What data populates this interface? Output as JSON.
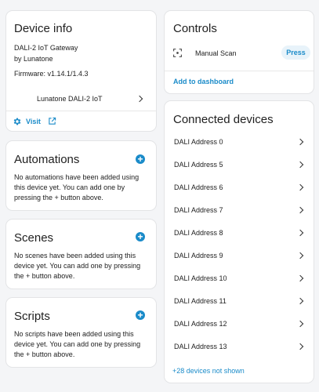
{
  "device_info": {
    "title": "Device info",
    "model": "DALI-2 IoT Gateway",
    "manufacturer": "by Lunatone",
    "firmware": "Firmware: v1.14.1/1.4.3",
    "entry_label": "Lunatone DALI-2 IoT",
    "visit_label": "Visit"
  },
  "automations": {
    "title": "Automations",
    "text": "No automations have been added using this device yet. You can add one by pressing the + button above."
  },
  "scenes": {
    "title": "Scenes",
    "text": "No scenes have been added using this device yet. You can add one by pressing the + button above."
  },
  "scripts": {
    "title": "Scripts",
    "text": "No scripts have been added using this device yet. You can add one by pressing the + button above."
  },
  "controls": {
    "title": "Controls",
    "entity_label": "Manual Scan",
    "press_label": "Press",
    "add_label": "Add to dashboard"
  },
  "connected": {
    "title": "Connected devices",
    "devices": [
      "DALI Address 0",
      "DALI Address 5",
      "DALI Address 6",
      "DALI Address 7",
      "DALI Address 8",
      "DALI Address 9",
      "DALI Address 10",
      "DALI Address 11",
      "DALI Address 12",
      "DALI Address 13"
    ],
    "more_label": "+28 devices not shown"
  }
}
